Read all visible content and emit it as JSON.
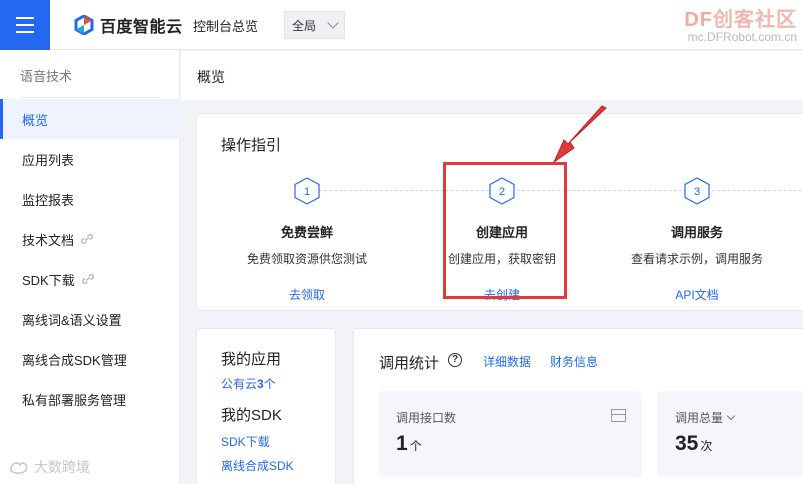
{
  "topbar": {
    "brand": "百度智能云",
    "console": "控制台总览",
    "region": "全局",
    "watermark_df": "DF",
    "watermark_rest": "创客社区",
    "watermark_url": "mc.DFRobot.com.cn"
  },
  "sidebar": {
    "heading": "语音技术",
    "items": [
      {
        "label": "概览"
      },
      {
        "label": "应用列表"
      },
      {
        "label": "监控报表"
      },
      {
        "label": "技术文档"
      },
      {
        "label": "SDK下载"
      },
      {
        "label": "离线词&语义设置"
      },
      {
        "label": "离线合成SDK管理"
      },
      {
        "label": "私有部署服务管理"
      }
    ],
    "bottom_watermark": "大数跨境"
  },
  "breadcrumb": "概览",
  "guide": {
    "title": "操作指引",
    "steps": [
      {
        "num": "1",
        "title": "免费尝鲜",
        "desc": "免费领取资源供您测试",
        "link": "去领取"
      },
      {
        "num": "2",
        "title": "创建应用",
        "desc": "创建应用，获取密钥",
        "link": "去创建"
      },
      {
        "num": "3",
        "title": "调用服务",
        "desc": "查看请求示例，调用服务",
        "link": "API文档"
      }
    ]
  },
  "apps": {
    "my_apps": "我的应用",
    "public_prefix": "公有云",
    "public_count": "3",
    "public_suffix": "个",
    "my_sdk": "我的SDK",
    "sdk_download": "SDK下载",
    "offline_sdk": "离线合成SDK"
  },
  "stats": {
    "title": "调用统计",
    "help_glyph": "?",
    "detail_link": "详细数据",
    "finance_link": "财务信息",
    "cards": [
      {
        "label": "调用接口数",
        "value": "1",
        "unit": "个"
      },
      {
        "label": "调用总量",
        "value": "35",
        "unit": "次"
      }
    ]
  },
  "colors": {
    "accent": "#2468f2",
    "highlight": "#e23a3a"
  }
}
